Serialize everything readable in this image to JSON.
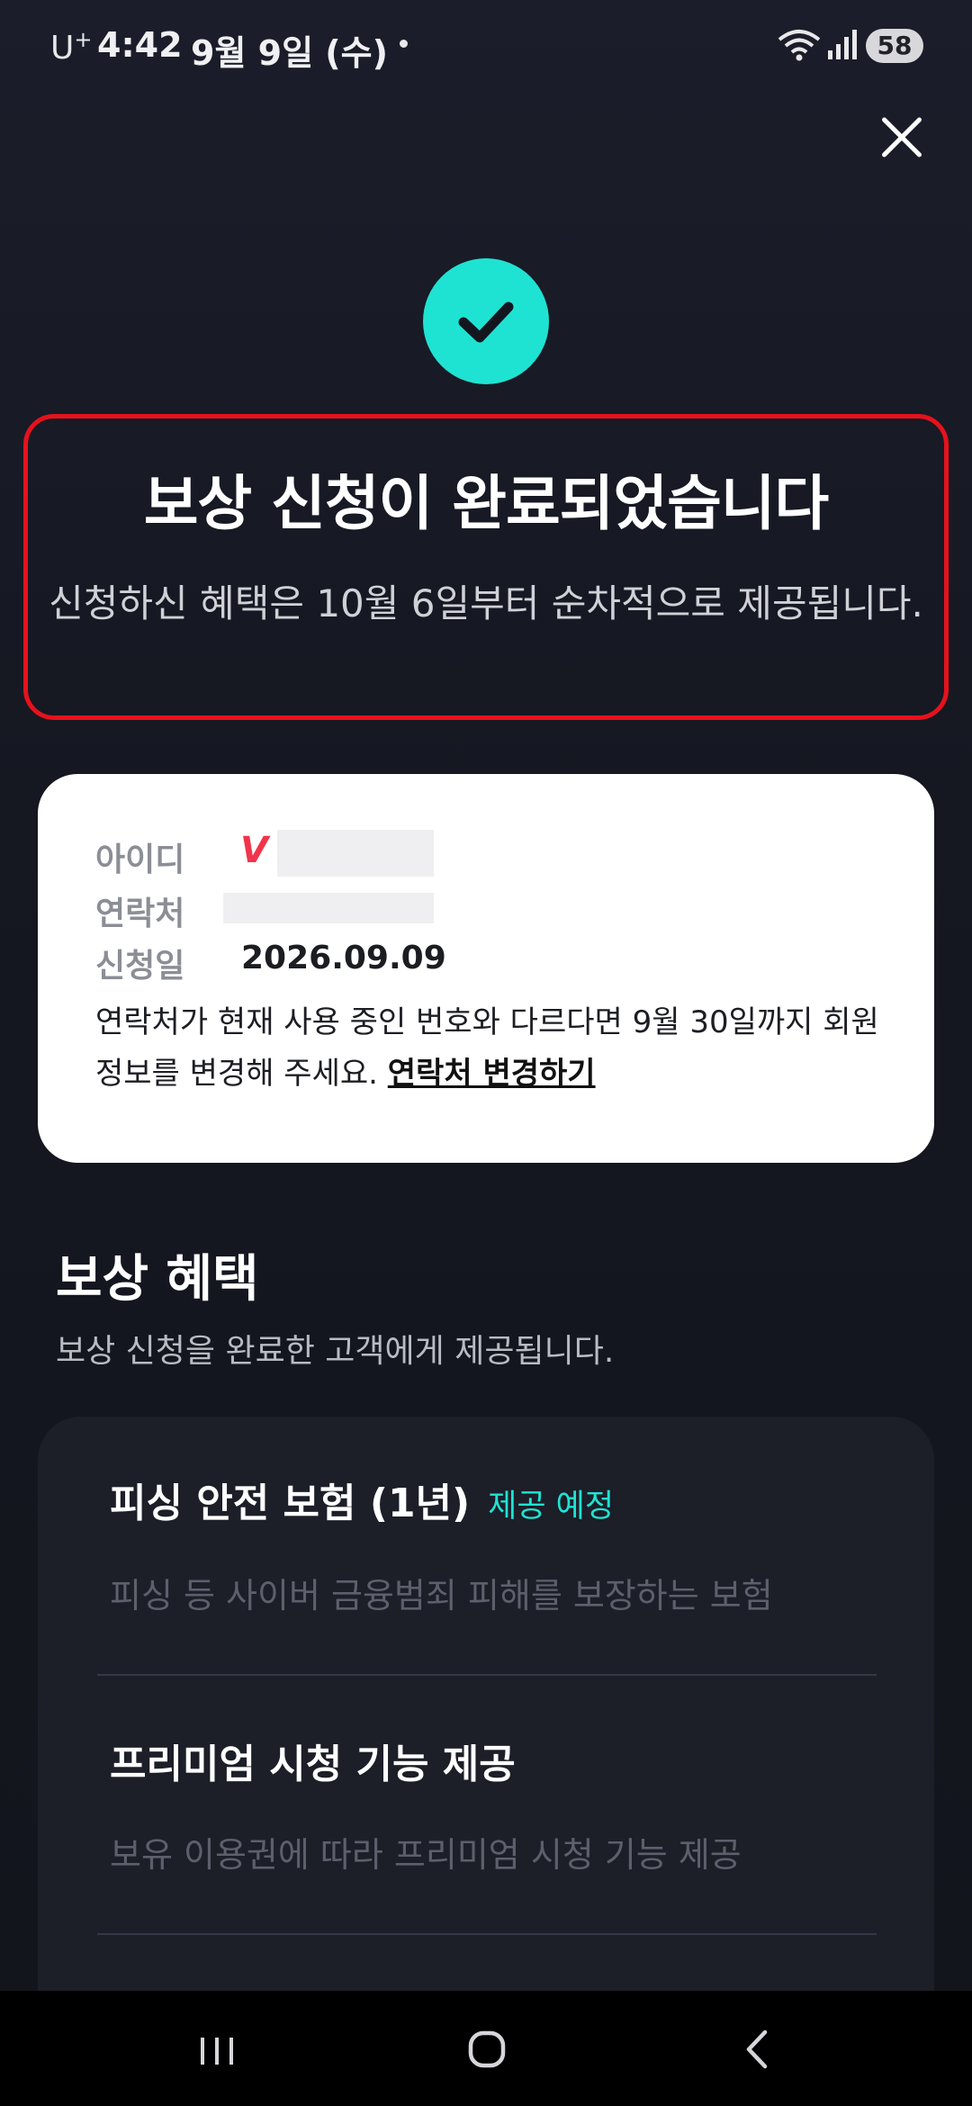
{
  "status_bar": {
    "carrier": "U",
    "carrier_sup": "+",
    "time": "4:42",
    "date": "9월 9일 (수)",
    "battery": "58"
  },
  "header": {
    "close_icon": "close-icon"
  },
  "result": {
    "title": "보상 신청이 완료되었습니다",
    "subtitle": "신청하신 혜택은 10월 6일부터 순차적으로 제공됩니다.",
    "accent_color": "#1fe3d2",
    "highlight_color": "#e5121c"
  },
  "info": {
    "id_label": "아이디",
    "id_logo": "V",
    "contact_label": "연락처",
    "date_label": "신청일",
    "date_value": "2026.09.09",
    "notice": "연락처가 현재 사용 중인 번호와 다르다면 9월 30일까지 회원정보를 변경해 주세요.",
    "change_link": "연락처 변경하기"
  },
  "benefits": {
    "title": "보상 혜택",
    "description": "보상 신청을 완료한 고객에게 제공됩니다.",
    "items": [
      {
        "title": "피싱 안전 보험 (1년)",
        "badge": "제공 예정",
        "desc": "피싱 등 사이버 금융범죄 피해를 보장하는 보험"
      },
      {
        "title": "프리미엄 시청 기능 제공",
        "badge": "",
        "desc": "보유 이용권에 따라 프리미엄 시청 기능 제공"
      }
    ]
  }
}
